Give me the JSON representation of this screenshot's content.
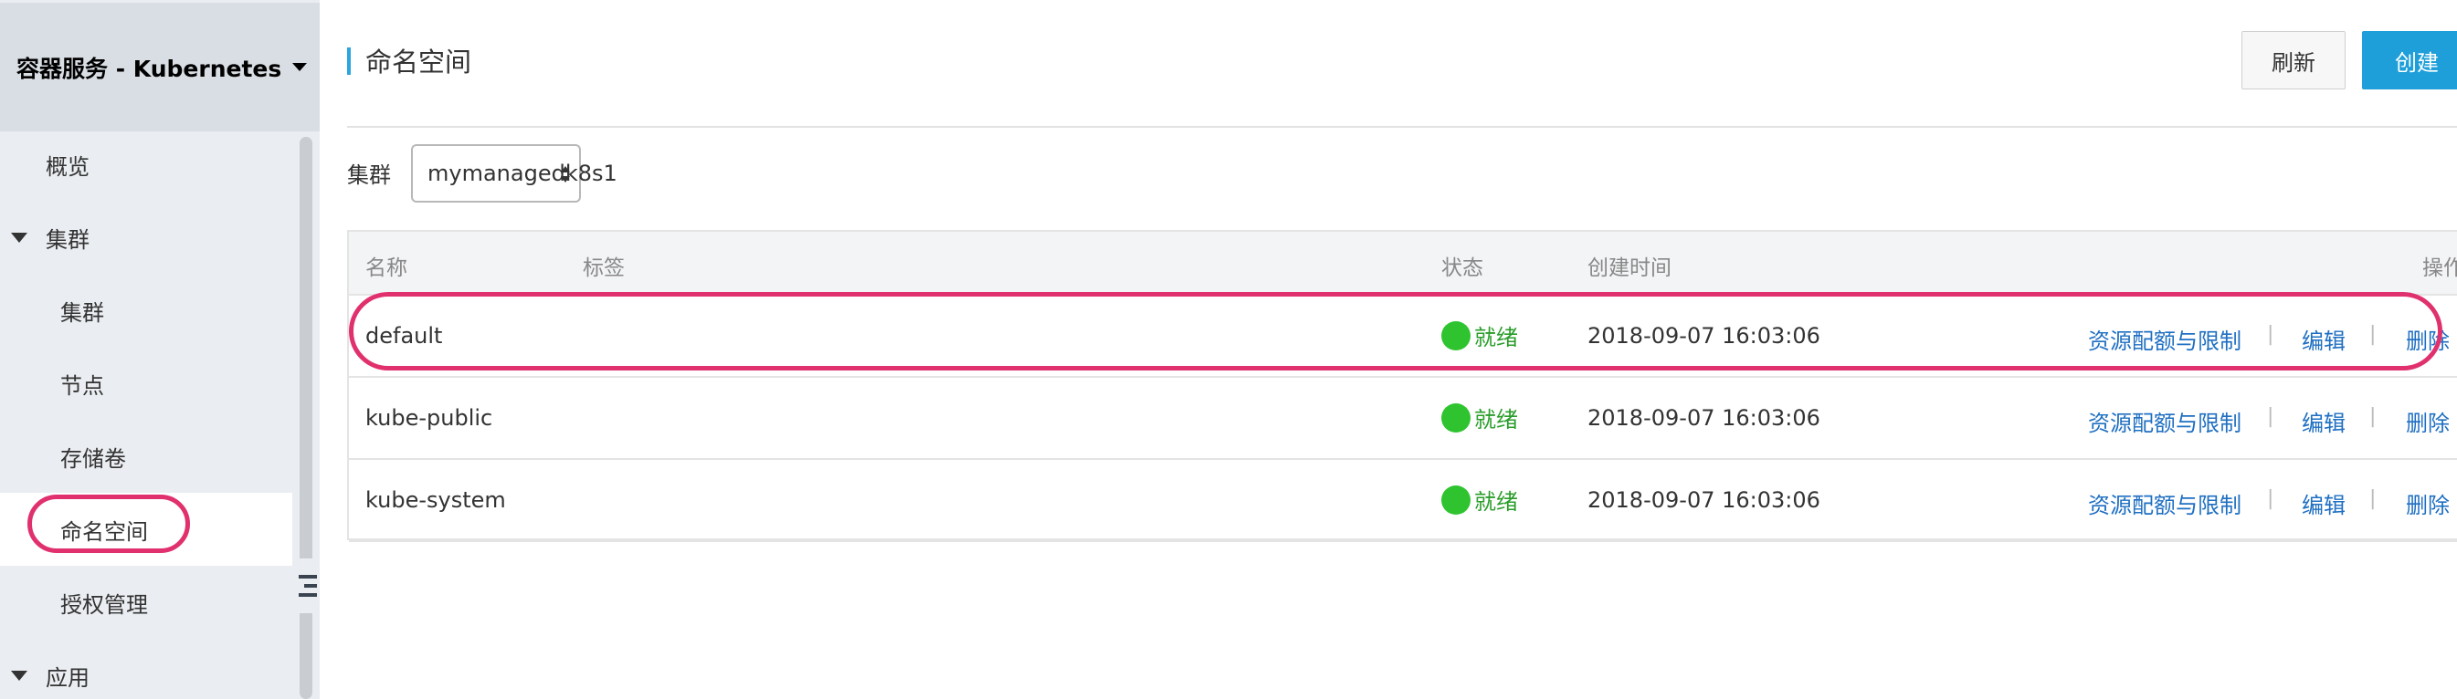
{
  "app": {
    "title": "容器服务 - Kubernetes"
  },
  "sidebar": {
    "items": [
      {
        "label": "概览"
      },
      {
        "label": "集群"
      },
      {
        "label": "集群"
      },
      {
        "label": "节点"
      },
      {
        "label": "存储卷"
      },
      {
        "label": "命名空间"
      },
      {
        "label": "授权管理"
      },
      {
        "label": "应用"
      }
    ]
  },
  "page": {
    "title": "命名空间"
  },
  "toolbar": {
    "refresh_label": "刷新",
    "create_label": "创建"
  },
  "filter": {
    "cluster_label": "集群",
    "cluster_value": "mymanagedk8s1"
  },
  "table": {
    "headers": {
      "name": "名称",
      "labels": "标签",
      "status": "状态",
      "created": "创建时间",
      "actions": "操作"
    },
    "rows": [
      {
        "name": "default",
        "status": "就绪",
        "created": "2018-09-07 16:03:06",
        "quota": "资源配额与限制",
        "edit": "编辑",
        "delete": "删除"
      },
      {
        "name": "kube-public",
        "status": "就绪",
        "created": "2018-09-07 16:03:06",
        "quota": "资源配额与限制",
        "edit": "编辑",
        "delete": "删除"
      },
      {
        "name": "kube-system",
        "status": "就绪",
        "created": "2018-09-07 16:03:06",
        "quota": "资源配额与限制",
        "edit": "编辑",
        "delete": "删除"
      }
    ],
    "separator": "|"
  },
  "colors": {
    "accent": "#1e9fd9",
    "highlight": "#e0316e",
    "status_ok": "#2fc42f",
    "link": "#1f6fc2"
  }
}
